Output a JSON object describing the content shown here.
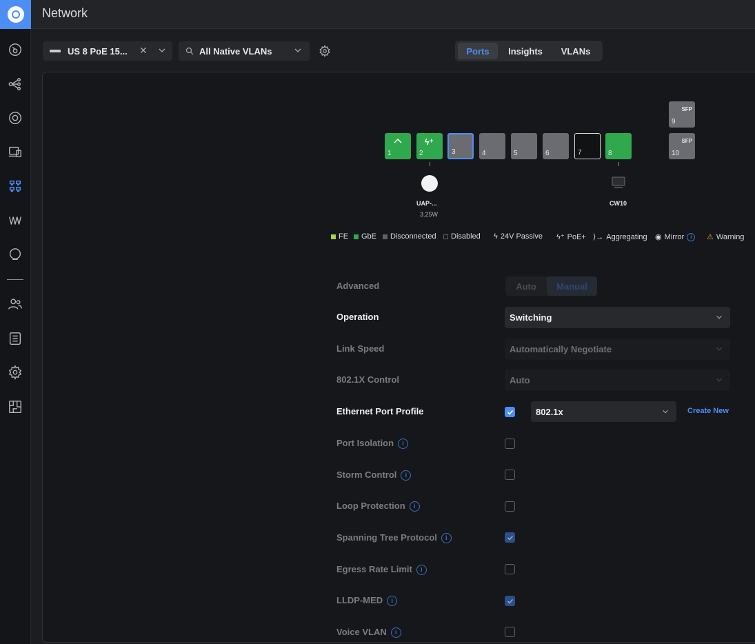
{
  "header": {
    "title": "Network"
  },
  "toolbar": {
    "device": "US 8 PoE 15...",
    "vlan_filter": "All Native VLANs"
  },
  "tabs": [
    {
      "label": "Ports",
      "active": true
    },
    {
      "label": "Insights",
      "active": false
    },
    {
      "label": "VLANs",
      "active": false
    }
  ],
  "ports": [
    {
      "number": "1",
      "state": "GbE"
    },
    {
      "number": "2",
      "state": "GbE PoE"
    },
    {
      "number": "3",
      "state": "Disconnected",
      "selected": true
    },
    {
      "number": "4",
      "state": "Disconnected"
    },
    {
      "number": "5",
      "state": "Disconnected"
    },
    {
      "number": "6",
      "state": "Disconnected"
    },
    {
      "number": "7",
      "state": "Disabled"
    },
    {
      "number": "8",
      "state": "GbE"
    },
    {
      "number": "9",
      "label": "SFP"
    },
    {
      "number": "10",
      "label": "SFP"
    }
  ],
  "clients": [
    {
      "port": "2",
      "name": "UAP-...",
      "detail": "3.25W",
      "icon": "access-point-icon"
    },
    {
      "port": "8",
      "name": "CW10",
      "detail": "",
      "icon": "monitor-icon"
    }
  ],
  "legend": [
    {
      "label": "FE",
      "color": "#a8d24a"
    },
    {
      "label": "GbE",
      "color": "#2fa84e"
    },
    {
      "label": "Disconnected",
      "color": "#5e6166"
    },
    {
      "label": "Disabled",
      "color": ""
    },
    {
      "label": "24V Passive",
      "icon": "bolt-icon"
    },
    {
      "label": "PoE+",
      "icon": "bolt-plus-icon"
    },
    {
      "label": "Aggregating",
      "icon": "aggregate-icon"
    },
    {
      "label": "Mirror",
      "icon": "eye-icon"
    },
    {
      "label": "Warning",
      "icon": "warning-icon",
      "color": "#e8a02c"
    }
  ],
  "settings": {
    "advanced": {
      "label": "Advanced",
      "options": [
        "Auto",
        "Manual"
      ],
      "selected": "Manual"
    },
    "operation": {
      "label": "Operation",
      "value": "Switching"
    },
    "link_speed": {
      "label": "Link Speed",
      "value": "Automatically Negotiate"
    },
    "dot1x_control": {
      "label": "802.1X Control",
      "value": "Auto"
    },
    "ethernet_port_profile": {
      "label": "Ethernet Port Profile",
      "checked": true,
      "value": "802.1x",
      "create_new": "Create New"
    },
    "port_isolation": {
      "label": "Port Isolation",
      "checked": false
    },
    "storm_control": {
      "label": "Storm Control",
      "checked": false
    },
    "loop_protection": {
      "label": "Loop Protection",
      "checked": false
    },
    "spanning_tree": {
      "label": "Spanning Tree Protocol",
      "checked": true
    },
    "egress_rate_limit": {
      "label": "Egress Rate Limit",
      "checked": false
    },
    "lldp_med": {
      "label": "LLDP-MED",
      "checked": true
    },
    "voice_vlan": {
      "label": "Voice VLAN",
      "checked": false
    }
  },
  "info_glyph": "i",
  "colors": {
    "accent": "#4d8ef5",
    "port_green": "#2fa84e",
    "port_gray": "#6a6c71",
    "warning": "#e8a02c"
  }
}
